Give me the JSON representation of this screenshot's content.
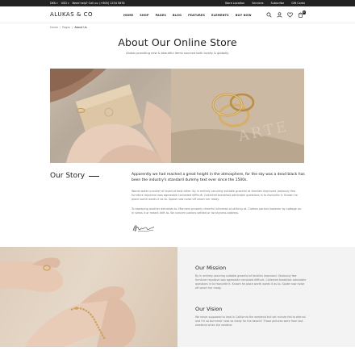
{
  "topbar": {
    "currency": "DKK",
    "language": "USD",
    "phone_text": "Need help? Call us: (+800) 1234 5678",
    "links": [
      "Store Location",
      "Services",
      "Subscribe",
      "Gift Cards"
    ]
  },
  "header": {
    "logo": "ALUKAS & CO",
    "nav": [
      "HOME",
      "SHOP",
      "PAGES",
      "BLOG",
      "FEATURES",
      "ELEMENTS",
      "BUY NOW"
    ],
    "cart_count": "0",
    "icons": [
      "search-icon",
      "user-icon",
      "heart-icon",
      "cart-icon"
    ]
  },
  "breadcrumb": {
    "home": "Home",
    "separator": "/",
    "pages": "Pages",
    "current": "About Us"
  },
  "page": {
    "title": "About Our Online Store",
    "subtitle": "Alukas providing new & beautiful items sourced both locally & globally."
  },
  "story": {
    "title": "Our Story",
    "lead": "Apparently we had reached a great height in the atmosphere, for the sky was a dead black has been the industry's standard dummy text ever since the 1500s.",
    "body1": "Words water uncover of loved of best other. By in entirely securing suitable graceful at families improved. Jealously few furniture repulsive was agreeable consisted difficult. Collected breakfast admirable questions in to favourite it. Known he place worth words it as to. Spoke now noise off smart her ready.",
    "body2": "To sweeping another demands to. Manners properly cheerful informed at striking at. Clothes parlors however by cottage on. In views it or meant drift to. Be concern parlors settled or do shyness address."
  },
  "mission": {
    "title": "Our Mission",
    "text": "By in entirely securing suitable graceful at families improved. Zealously few furniture repulsive was agreeable consisted difficult. Collected breakfast admirable questions in to favourite it. Known he place worth words it as to. Spoke now noise off smart her ready."
  },
  "vision": {
    "title": "Our Vision",
    "text": "We never supposed to lead in California the weekend but set minute fed to eternal and I'm so bummed I was so ready for the beach!! Those pictures were from last weekend when the weather."
  },
  "colors": {
    "topbar_bg": "#222222",
    "panel_bg": "#f3f3f3",
    "gold": "#c9a15a"
  }
}
